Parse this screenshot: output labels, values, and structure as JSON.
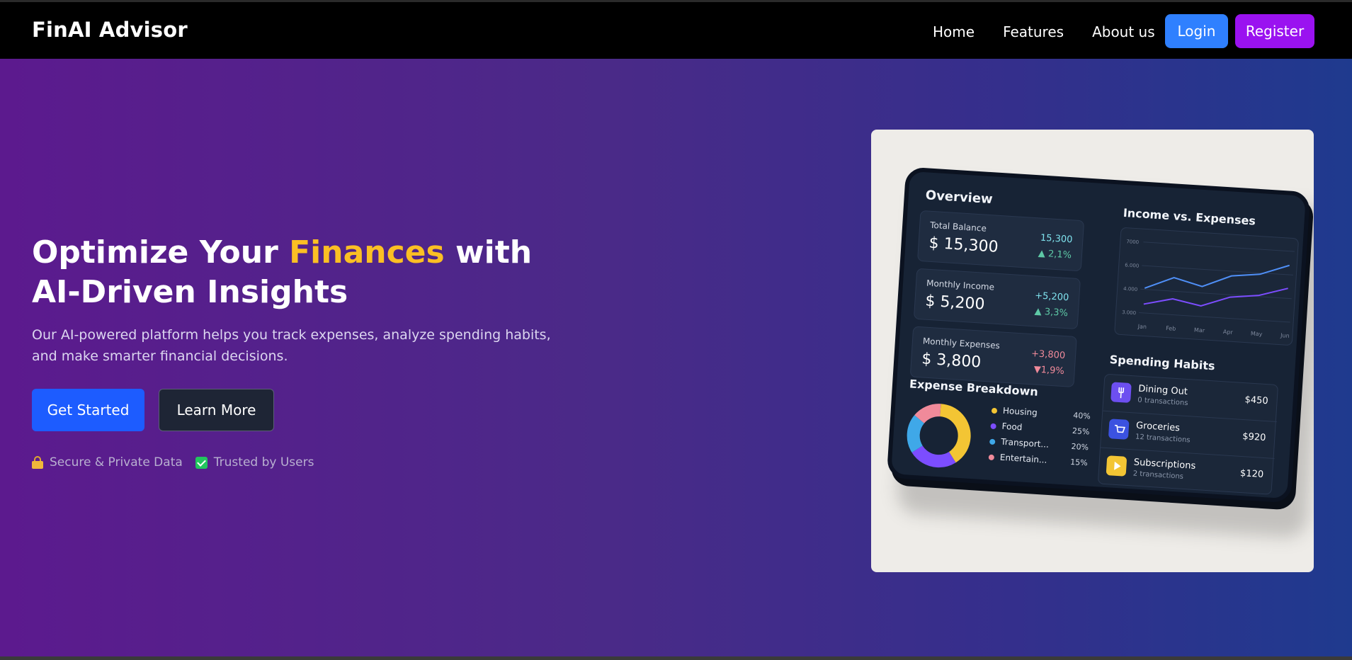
{
  "app": {
    "brand": "FinAI Advisor"
  },
  "nav": {
    "links": [
      "Home",
      "Features",
      "About us"
    ],
    "login": "Login",
    "register": "Register"
  },
  "hero": {
    "title_pre": "Optimize Your ",
    "title_accent": "Finances",
    "title_post": " with AI-Driven Insights",
    "subtitle": "Our AI-powered platform helps you track expenses, analyze spending habits, and make smarter financial decisions.",
    "cta_primary": "Get Started",
    "cta_secondary": "Learn More",
    "trust": [
      "Secure & Private Data",
      "Trusted by Users"
    ]
  },
  "dashboard": {
    "overview_title": "Overview",
    "stats": [
      {
        "label": "Total Balance",
        "value": "$ 15,300",
        "change": "15,300",
        "pct": "▲ 2,1%",
        "negative": false
      },
      {
        "label": "Monthly Income",
        "value": "$ 5,200",
        "change": "+5,200",
        "pct": "▲ 3,3%",
        "negative": false
      },
      {
        "label": "Monthly Expenses",
        "value": "$ 3,800",
        "change": "+3,800",
        "pct": "▼1,9%",
        "negative": true
      }
    ],
    "income_title": "Income vs. Expenses",
    "chart_data": {
      "type": "line",
      "categories": [
        "Jan",
        "Feb",
        "Mar",
        "Apr",
        "May",
        "Jun"
      ],
      "y_ticks": [
        "7000",
        "6.000",
        "4.000",
        "3.000"
      ],
      "series": [
        {
          "values": [
            4400,
            5100,
            4700,
            5400,
            5600,
            6200
          ],
          "color": "#4f8ff7"
        },
        {
          "values": [
            3500,
            3900,
            3600,
            4200,
            4400,
            4900
          ],
          "color": "#7c4dff"
        }
      ],
      "ylim": [
        3000,
        7000
      ]
    },
    "habits_title": "Spending Habits",
    "habits": [
      {
        "name": "Dining Out",
        "sub": "0 transactions",
        "amount": "$450",
        "color": "#6d4ff0",
        "icon": "fork-knife-icon"
      },
      {
        "name": "Groceries",
        "sub": "12 transactions",
        "amount": "$920",
        "color": "#3b52e0",
        "icon": "cart-icon"
      },
      {
        "name": "Subscriptions",
        "sub": "2 transactions",
        "amount": "$120",
        "color": "#f3c534",
        "icon": "play-icon"
      }
    ],
    "breakdown_title": "Expense Breakdown",
    "breakdown": [
      {
        "name": "Housing",
        "pct": "40%",
        "color": "#f3c534",
        "value": 40
      },
      {
        "name": "Food",
        "pct": "25%",
        "color": "#7c4dff",
        "value": 25
      },
      {
        "name": "Transport...",
        "pct": "20%",
        "color": "#3fa8e8",
        "value": 20
      },
      {
        "name": "Entertain...",
        "pct": "15%",
        "color": "#f08a9a",
        "value": 15
      }
    ]
  }
}
